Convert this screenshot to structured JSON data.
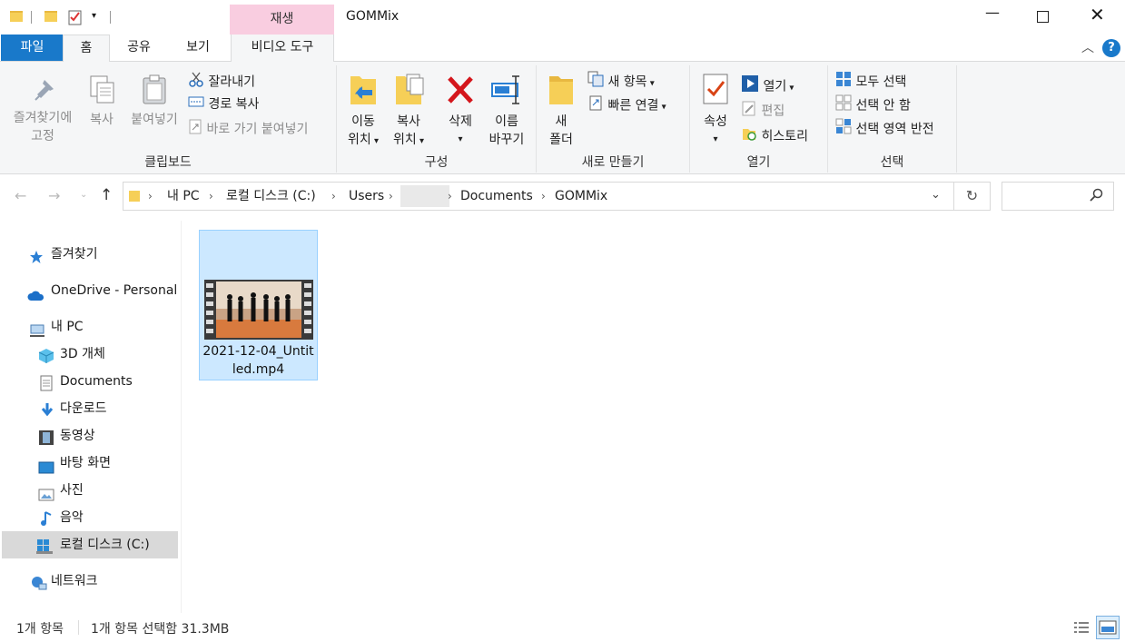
{
  "window": {
    "title": "GOMMix",
    "context_tab": "재생"
  },
  "tabs": {
    "file": "파일",
    "home": "홈",
    "share": "공유",
    "view": "보기",
    "video_tools": "비디오 도구"
  },
  "ribbon": {
    "clipboard": {
      "label": "클립보드",
      "pin_line1": "즐겨찾기에",
      "pin_line2": "고정",
      "copy": "복사",
      "paste": "붙여넣기",
      "cut": "잘라내기",
      "copy_path": "경로 복사",
      "paste_shortcut": "바로 가기 붙여넣기"
    },
    "organize": {
      "label": "구성",
      "move_line1": "이동",
      "move_line2": "위치",
      "copyto_line1": "복사",
      "copyto_line2": "위치",
      "delete": "삭제",
      "rename_line1": "이름",
      "rename_line2": "바꾸기"
    },
    "new": {
      "label": "새로 만들기",
      "newfolder_line1": "새",
      "newfolder_line2": "폴더",
      "new_item": "새 항목",
      "easy_access": "빠른 연결"
    },
    "open": {
      "label": "열기",
      "properties": "속성",
      "open": "열기",
      "edit": "편집",
      "history": "히스토리"
    },
    "select": {
      "label": "선택",
      "select_all": "모두 선택",
      "select_none": "선택 안 함",
      "invert": "선택 영역 반전"
    }
  },
  "address": {
    "crumbs": [
      "내 PC",
      "로컬 디스크 (C:)",
      "Users",
      "Documents",
      "GOMMix"
    ],
    "search_placeholder": ""
  },
  "nav": {
    "quick_access": "즐겨찾기",
    "onedrive": "OneDrive - Personal",
    "this_pc": "내 PC",
    "objects3d": "3D 개체",
    "documents": "Documents",
    "downloads": "다운로드",
    "videos": "동영상",
    "desktop": "바탕 화면",
    "pictures": "사진",
    "music": "음악",
    "local_disk": "로컬 디스크 (C:)",
    "network": "네트워크"
  },
  "files": [
    {
      "name_line1": "2021-12-04_Untit",
      "name_line2": "led.mp4",
      "type": "video"
    }
  ],
  "status": {
    "count": "1개 항목",
    "selected": "1개 항목 선택함 31.3MB"
  },
  "colors": {
    "file_tab": "#1979ca",
    "context_tab": "#f9cde0",
    "selection": "#cce8ff",
    "selection_border": "#99d1ff",
    "help": "#1979ca"
  }
}
